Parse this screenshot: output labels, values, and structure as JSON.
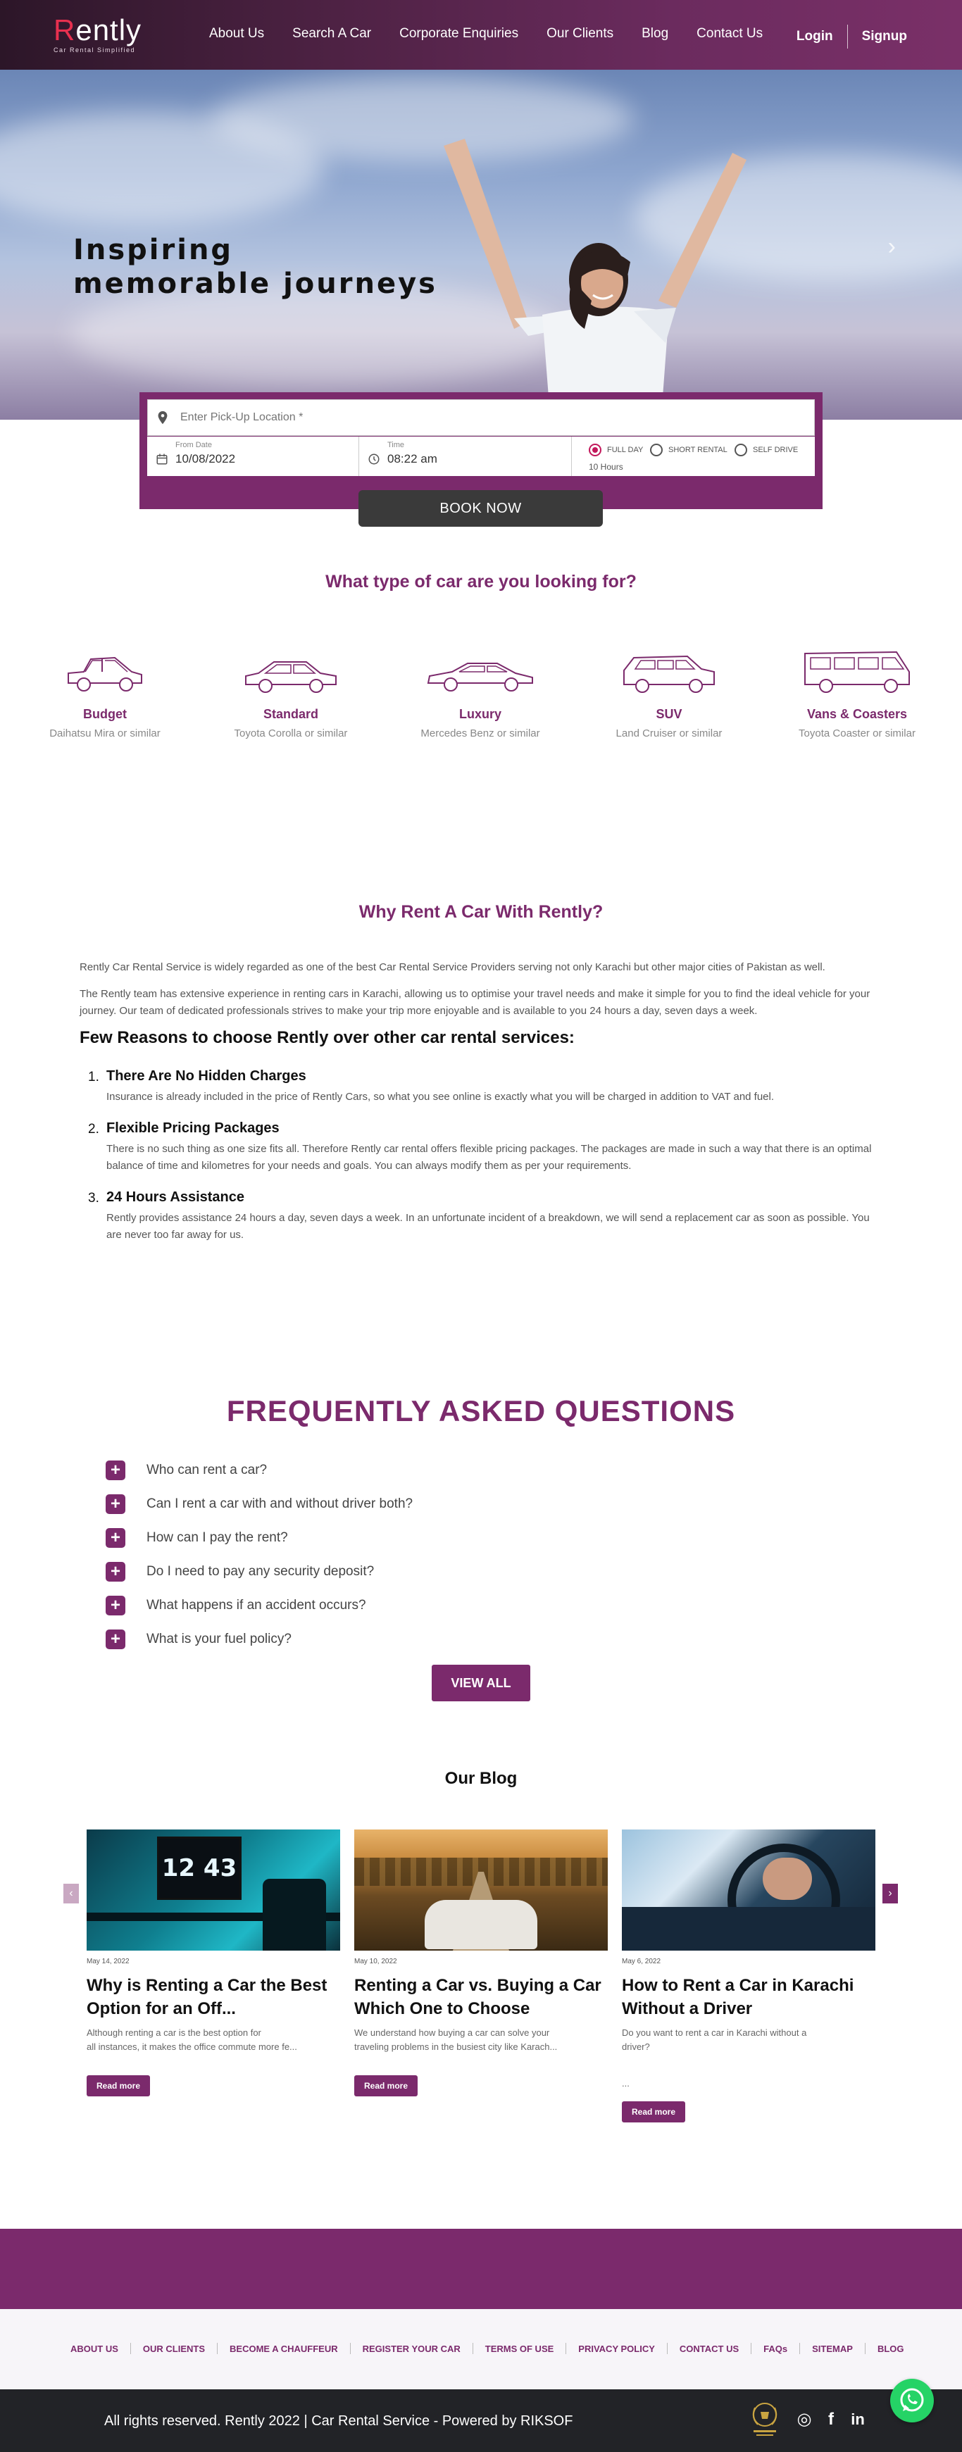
{
  "header": {
    "logo_text_first": "R",
    "logo_text_rest": "ently",
    "logo_tagline": "Car Rental Simplified",
    "nav": [
      "About Us",
      "Search A Car",
      "Corporate Enquiries",
      "Our Clients",
      "Blog",
      "Contact Us"
    ],
    "login": "Login",
    "signup": "Signup"
  },
  "hero": {
    "title_line1": "Inspiring",
    "title_line2": "memorable journeys",
    "next_arrow": "›"
  },
  "booking": {
    "location_placeholder": "Enter Pick-Up Location *",
    "from_date_label": "From Date",
    "from_date_value": "10/08/2022",
    "time_label": "Time",
    "time_value": "08:22 am",
    "options": [
      "FULL DAY",
      "SHORT RENTAL",
      "SELF DRIVE"
    ],
    "selected_option": "FULL DAY",
    "hours": "10 Hours",
    "book_button": "BOOK NOW"
  },
  "car_types": {
    "heading": "What type of car are you looking for?",
    "items": [
      {
        "name": "Budget",
        "example": "Daihatsu Mira or similar",
        "icon": "hatchback-car-icon"
      },
      {
        "name": "Standard",
        "example": "Toyota Corolla or similar",
        "icon": "sedan-car-icon"
      },
      {
        "name": "Luxury",
        "example": "Mercedes Benz or similar",
        "icon": "luxury-car-icon"
      },
      {
        "name": "SUV",
        "example": "Land Cruiser or similar",
        "icon": "suv-car-icon"
      },
      {
        "name": "Vans & Coasters",
        "example": "Toyota Coaster or similar",
        "icon": "van-icon"
      }
    ]
  },
  "why": {
    "heading": "Why Rent A Car With Rently?",
    "para1": "Rently Car Rental Service is widely regarded as one of the best Car Rental Service Providers serving not only Karachi but other major cities of Pakistan as well.",
    "para2": "The Rently team has extensive experience in renting cars in Karachi, allowing us to optimise your travel needs and make it simple for you to find the ideal vehicle for your journey. Our team of dedicated professionals strives to make your trip more enjoyable and is available to you 24 hours a day, seven days a week.",
    "reasons_heading": "Few Reasons to choose Rently over other car rental services:",
    "reasons": [
      {
        "num": "1.",
        "title": "There Are No Hidden Charges",
        "desc": "Insurance is already included in the price of Rently Cars, so what you see online is exactly what you will be charged in addition to VAT and fuel."
      },
      {
        "num": "2.",
        "title": "Flexible Pricing Packages",
        "desc": "There is no such thing as one size fits all. Therefore Rently car rental offers flexible pricing packages. The packages are made in such a way that there is an optimal balance of time and kilometres for your needs and goals. You can always modify them as per your requirements."
      },
      {
        "num": "3.",
        "title": "24 Hours Assistance",
        "desc": "Rently provides assistance 24 hours a day, seven days a week. In an unfortunate incident of a breakdown, we will send a replacement car as soon as possible. You are never too far away for us."
      }
    ]
  },
  "faq": {
    "heading": "FREQUENTLY ASKED QUESTIONS",
    "questions": [
      "Who can rent a car?",
      "Can I rent a car with and without driver both?",
      "How can I pay the rent?",
      "Do I need to pay any security deposit?",
      "What happens if an accident occurs?",
      "What is your fuel policy?"
    ],
    "view_all": "VIEW ALL"
  },
  "blog": {
    "heading": "Our Blog",
    "prev": "‹",
    "next": "›",
    "posts": [
      {
        "date": "May 14, 2022",
        "title": "Why is Renting a Car the Best Option for an Off...",
        "excerpt": "Although renting a car is the best option for\nall instances, it makes the office commute more fe...",
        "read_more": "Read more",
        "image_clock": "12 43"
      },
      {
        "date": "May 10, 2022",
        "title": "Renting a Car vs. Buying a Car Which One to Choose",
        "excerpt": "We understand how buying a car can solve your\ntraveling problems in the busiest city like Karach...",
        "read_more": "Read more"
      },
      {
        "date": "May 6, 2022",
        "title": "How to Rent a Car in Karachi Without a Driver",
        "excerpt": "Do you want to rent a car in Karachi without a\ndriver?",
        "trailing": "...",
        "read_more": "Read more"
      }
    ]
  },
  "footer": {
    "links": [
      "ABOUT US",
      "OUR CLIENTS",
      "BECOME A CHAUFFEUR",
      "REGISTER YOUR CAR",
      "TERMS OF USE",
      "PRIVACY POLICY",
      "CONTACT US",
      "FAQs",
      "SITEMAP",
      "BLOG"
    ],
    "copyright": "All rights reserved. Rently 2022 | Car Rental Service - Powered by RIKSOF",
    "social_icons": [
      "instagram-icon",
      "facebook-icon",
      "linkedin-icon"
    ],
    "social_glyphs": [
      "◎",
      "f",
      "in"
    ]
  },
  "colors": {
    "brand": "#7b2a6c",
    "accent_red": "#e8304f",
    "dark": "#222327",
    "whatsapp": "#25d366"
  }
}
